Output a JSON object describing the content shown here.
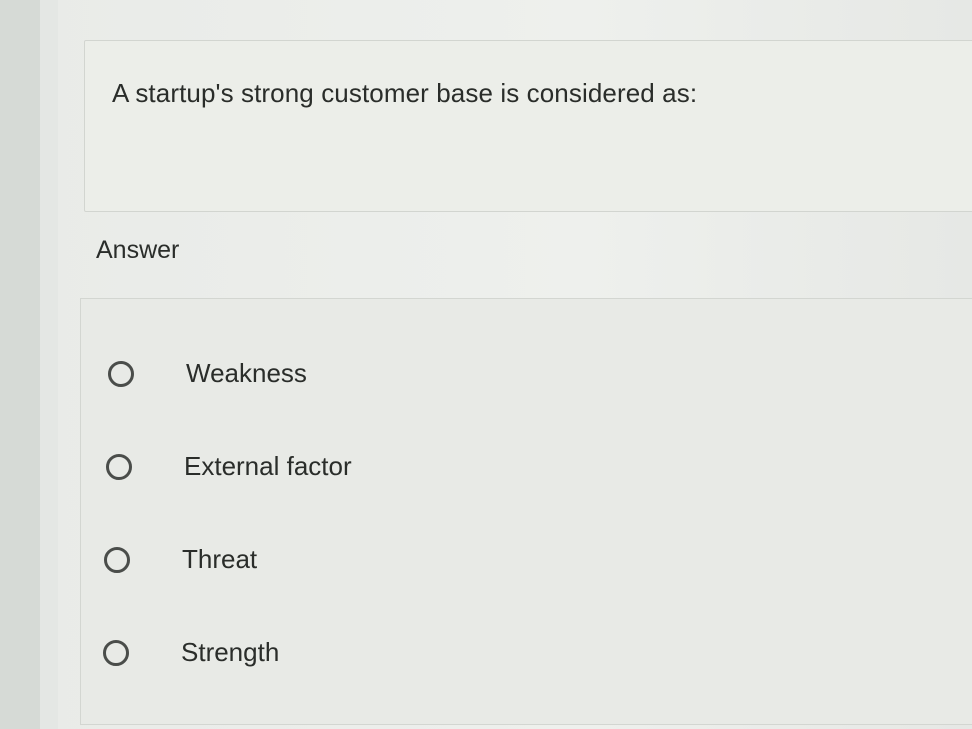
{
  "question": {
    "text": "A startup's strong customer base is considered as:"
  },
  "answer": {
    "label": "Answer",
    "options": [
      {
        "label": "Weakness",
        "selected": false
      },
      {
        "label": "External factor",
        "selected": false
      },
      {
        "label": "Threat",
        "selected": false
      },
      {
        "label": "Strength",
        "selected": false
      }
    ]
  }
}
